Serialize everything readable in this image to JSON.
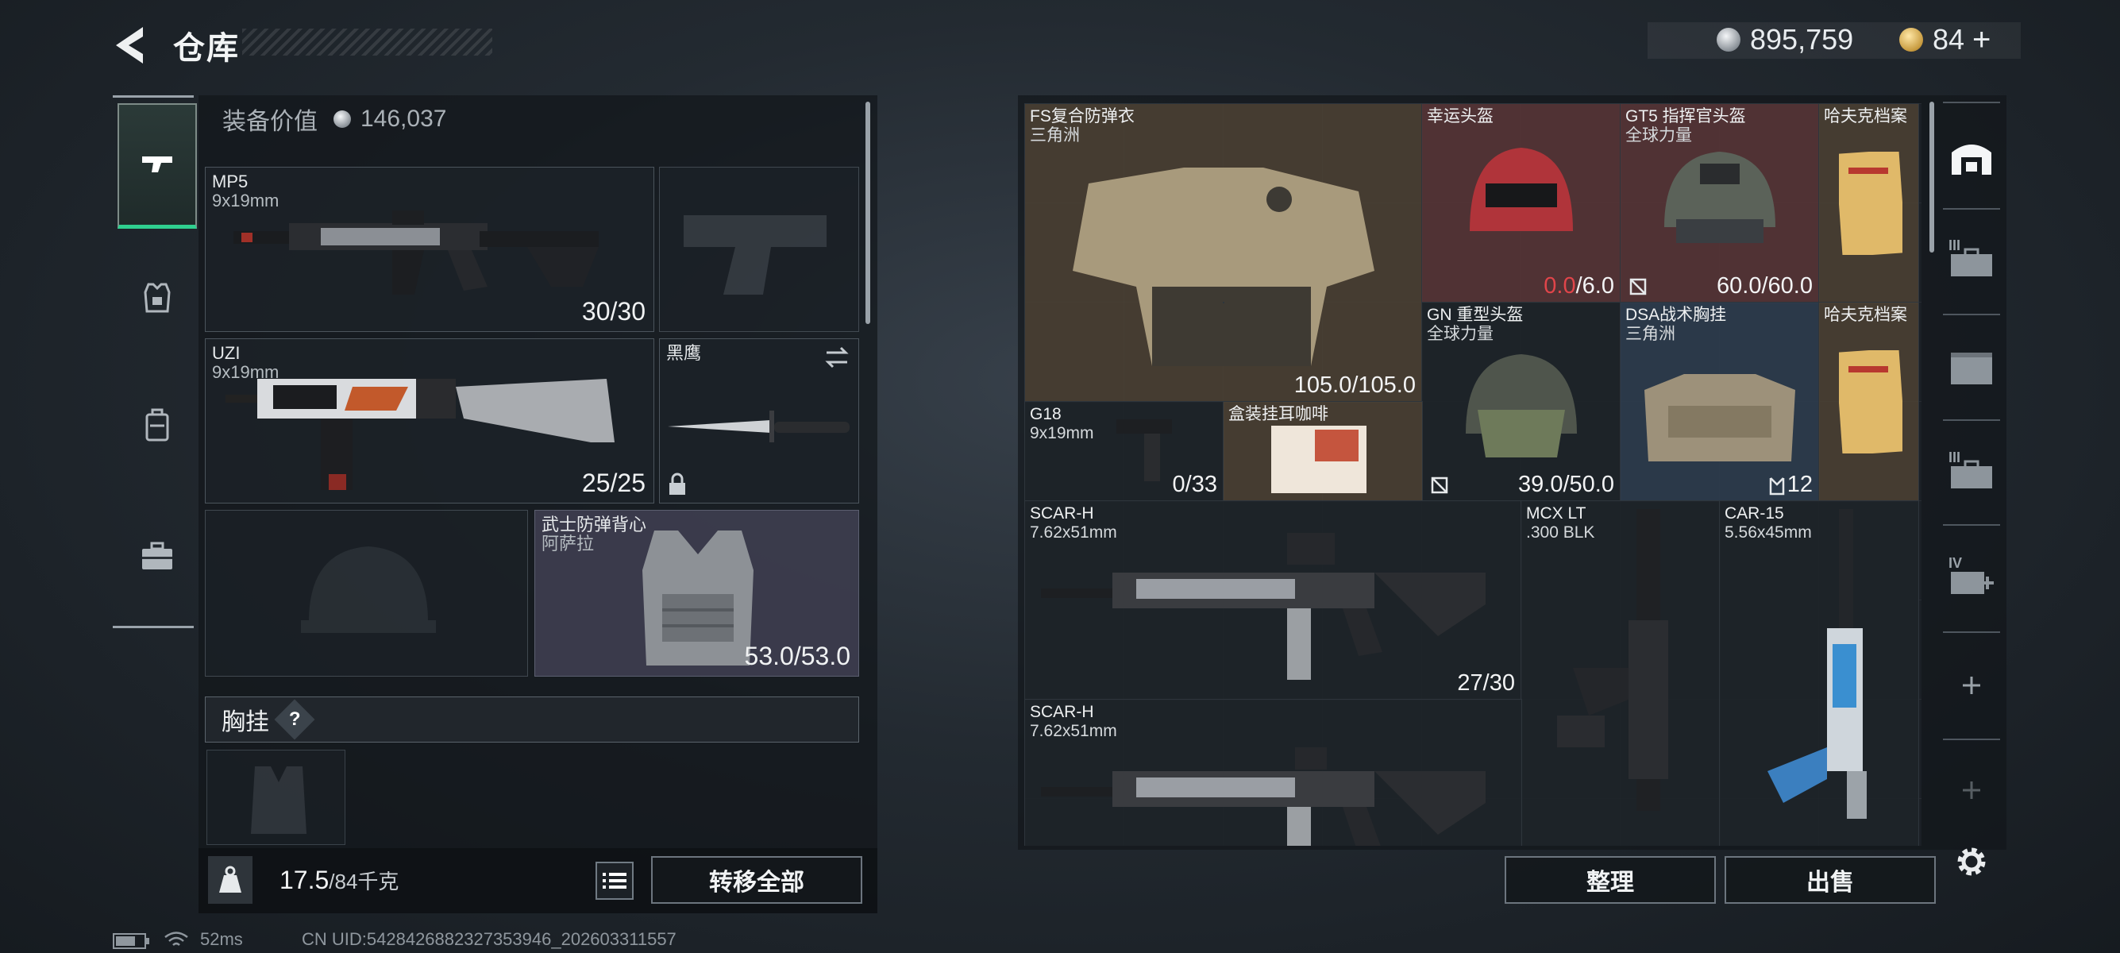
{
  "header": {
    "title": "仓库",
    "currency": {
      "silver": "895,759",
      "gold": "84",
      "add": "+"
    }
  },
  "loadout": {
    "equip_value_label": "装备价值",
    "equip_value": "146,037",
    "primary": {
      "name": "MP5",
      "caliber": "9x19mm",
      "ammo": "30/30"
    },
    "secondary": {
      "name": "UZI",
      "caliber": "9x19mm",
      "ammo": "25/25"
    },
    "melee": {
      "name": "黑鹰"
    },
    "armor": {
      "name": "武士防弹背心",
      "source": "阿萨拉",
      "durability": "53.0/53.0"
    },
    "chest_rig_label": "胸挂",
    "chest_rig_help": "?",
    "weight": "17.5",
    "weight_max": "/84千克",
    "transfer_all": "转移全部"
  },
  "storage": {
    "items": [
      {
        "name": "FS复合防弹衣",
        "sub": "三角洲",
        "value": "105.0/105.0"
      },
      {
        "name": "幸运头盔",
        "sub": "",
        "value_red": "0.0",
        "value": "/6.0"
      },
      {
        "name": "GT5 指挥官头盔",
        "sub": "全球力量",
        "value": "60.0/60.0"
      },
      {
        "name": "哈夫克档案",
        "sub": "",
        "value": ""
      },
      {
        "name": "GN 重型头盔",
        "sub": "全球力量",
        "value": "39.0/50.0"
      },
      {
        "name": "DSA战术胸挂",
        "sub": "三角洲",
        "value": "12"
      },
      {
        "name": "哈夫克档案",
        "sub": "",
        "value": ""
      },
      {
        "name": "G18",
        "sub": "9x19mm",
        "value": "0/33"
      },
      {
        "name": "盒装挂耳咖啡",
        "sub": "",
        "value": ""
      },
      {
        "name": "SCAR-H",
        "sub": "7.62x51mm",
        "value": "27/30"
      },
      {
        "name": "MCX LT",
        "sub": ".300 BLK",
        "value": ""
      },
      {
        "name": "CAR-15",
        "sub": "5.56x45mm",
        "value": ""
      },
      {
        "name": "SCAR-H",
        "sub": "7.62x51mm",
        "value": ""
      }
    ],
    "sort_button": "整理",
    "sell_button": "出售"
  },
  "side_tabs": [
    "III",
    "III",
    "IV"
  ],
  "status_bar": {
    "ping": "52ms",
    "uid": "CN UID:5428426882327353946_202603311557"
  },
  "colors": {
    "accent_green": "#2fd08f",
    "broken_red": "#e0454a"
  }
}
